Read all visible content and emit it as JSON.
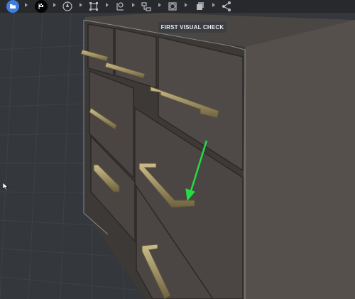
{
  "toolbar": {
    "steps": [
      {
        "icon": "folder-icon",
        "state": "active"
      },
      {
        "icon": "checkered-flag-icon",
        "state": "active"
      },
      {
        "icon": "compass-icon",
        "state": "idle"
      },
      {
        "icon": "bounding-box-icon",
        "state": "idle"
      },
      {
        "icon": "pivot-icon",
        "state": "idle"
      },
      {
        "icon": "hierarchy-icon",
        "state": "idle"
      },
      {
        "icon": "material-sphere-icon",
        "state": "idle"
      },
      {
        "icon": "layers-icon",
        "state": "idle"
      },
      {
        "icon": "share-icon",
        "state": "idle"
      }
    ],
    "separator_icon": "chevron-right-icon"
  },
  "viewport": {
    "stage_label": "FIRST VISUAL CHECK",
    "annotation_color": "#22dd44",
    "model": "dresser"
  },
  "colors": {
    "active_blue": "#3f7de0",
    "grid_bg": "#34373b",
    "wood": "#4c4744",
    "handle": "#9a8b5c"
  }
}
